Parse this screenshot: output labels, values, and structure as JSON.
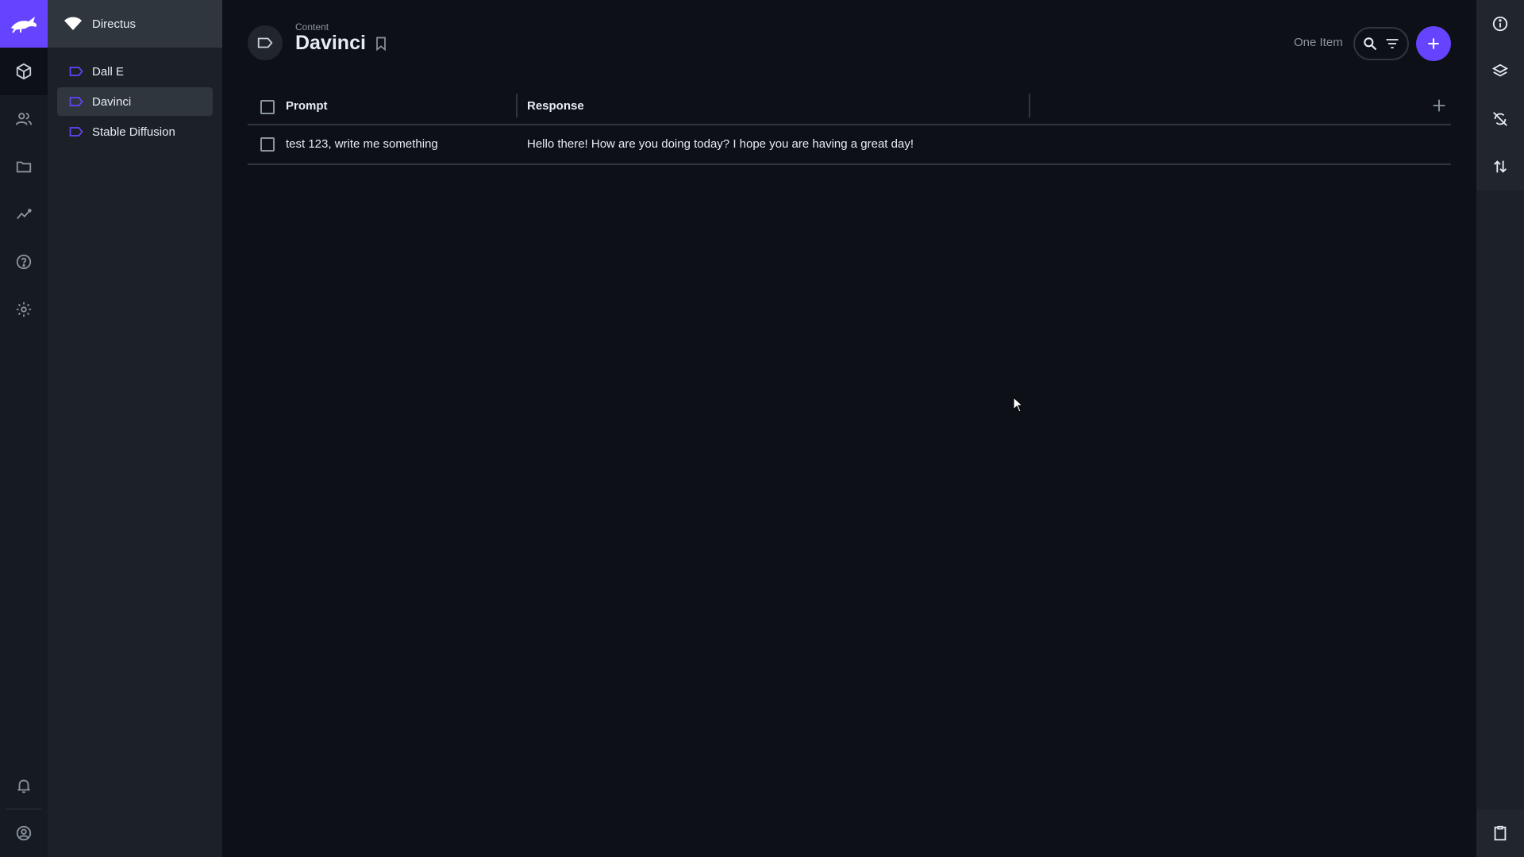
{
  "project": {
    "name": "Directus"
  },
  "nav": {
    "items": [
      {
        "label": "Dall E",
        "active": false
      },
      {
        "label": "Davinci",
        "active": true
      },
      {
        "label": "Stable Diffusion",
        "active": false
      }
    ]
  },
  "header": {
    "breadcrumb": "Content",
    "title": "Davinci",
    "item_count": "One Item"
  },
  "table": {
    "columns": [
      "Prompt",
      "Response"
    ],
    "rows": [
      {
        "prompt": "test 123, write me something",
        "response": "Hello there! How are you doing today? I hope you are having a great day!"
      }
    ]
  },
  "colors": {
    "accent": "#6644ff",
    "background": "#0d1117",
    "nav_background": "#1c2128",
    "module_bar": "#161b22"
  },
  "icons": {
    "module_bar": [
      "directus-logo-icon",
      "content-box-icon",
      "users-icon",
      "folder-icon",
      "insights-icon",
      "help-icon",
      "settings-gear-icon",
      "bell-icon",
      "account-circle-icon"
    ],
    "sidebar": [
      "info-icon",
      "layers-icon",
      "sync-disabled-icon",
      "import-export-icon",
      "clipboard-icon"
    ]
  }
}
